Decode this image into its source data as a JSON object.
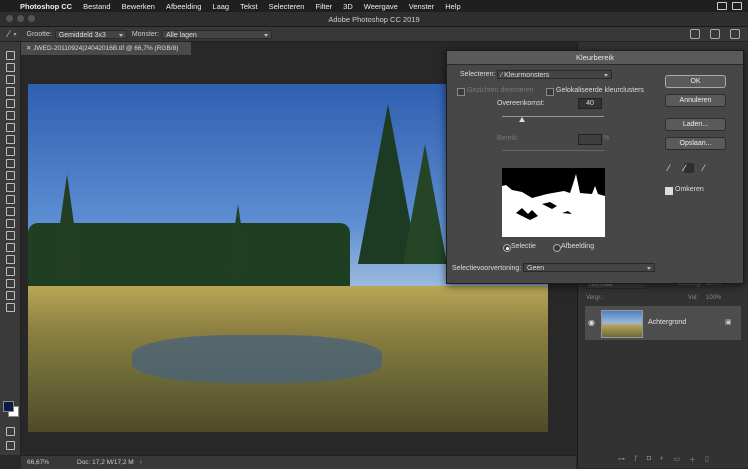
{
  "menubar": {
    "items": [
      "Photoshop CC",
      "Bestand",
      "Bewerken",
      "Afbeelding",
      "Laag",
      "Tekst",
      "Selecteren",
      "Filter",
      "3D",
      "Weergave",
      "Venster",
      "Help"
    ]
  },
  "window": {
    "title": "Adobe Photoshop CC 2019"
  },
  "options": {
    "size_label": "Grootte:",
    "size_value": "Gemiddeld 3x3",
    "sample_label": "Monster:",
    "sample_value": "Alle lagen"
  },
  "document": {
    "tab_title": "JWED-20110924|24042016B.tif @ 66,7% (RGB/8)",
    "zoom": "66,67%",
    "doc_info": "Doc: 17,2 M/17,2 M"
  },
  "layers": {
    "layer_name": "Achtergrond",
    "blend_mode": "Normaal",
    "opacity_label": "Dekking:",
    "opacity_value": "100%",
    "lock_label": "Vergr.:",
    "fill_label": "Vul:",
    "fill_value": "100%"
  },
  "dialog": {
    "title": "Kleurbereik",
    "select_label": "Selecteren:",
    "select_value": "Kleurmonsters",
    "detect_faces": "Gezichten detecteren",
    "localized_clusters": "Gelokaliseerde kleurclusters",
    "fuzziness_label": "Overeenkomst:",
    "fuzziness_value": "40",
    "fuzziness_level": 0.2,
    "range_label": "Bereik:",
    "range_unit": "%",
    "ok": "OK",
    "cancel": "Annuleren",
    "load": "Laden...",
    "save": "Opslaan...",
    "invert": "Omkeren",
    "radio_selection": "Selectie",
    "radio_image": "Afbeelding",
    "preview_label": "Selectievoorvertoning:",
    "preview_value": "Geen"
  },
  "colors": {
    "foreground": "#0b1a44",
    "background": "#ffffff",
    "accent": "#4a90d9"
  }
}
